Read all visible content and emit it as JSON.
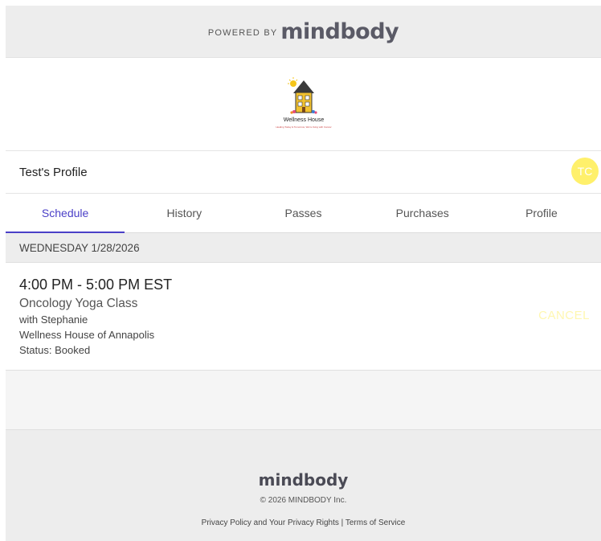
{
  "banner": {
    "powered_by": "POWERED BY",
    "brand": "mindbody"
  },
  "studio_logo": {
    "name": "Wellness House",
    "tagline": "Healing Today & Tomorrow, We're living with Cancer"
  },
  "profile": {
    "title": "Test's Profile",
    "avatar_initials": "TC"
  },
  "tabs": [
    {
      "label": "Schedule",
      "active": true
    },
    {
      "label": "History",
      "active": false
    },
    {
      "label": "Passes",
      "active": false
    },
    {
      "label": "Purchases",
      "active": false
    },
    {
      "label": "Profile",
      "active": false
    }
  ],
  "schedule": {
    "date_header": "WEDNESDAY 1/28/2026",
    "item": {
      "time": "4:00 PM - 5:00 PM EST",
      "class_name": "Oncology Yoga Class",
      "instructor": "with Stephanie",
      "location": "Wellness House of Annapolis",
      "status": "Status: Booked",
      "cancel_label": "CANCEL"
    }
  },
  "footer": {
    "brand": "mindbody",
    "copyright": "© 2026 MINDBODY Inc.",
    "privacy_link": "Privacy Policy and Your Privacy Rights",
    "separator": "|",
    "terms_link": "Terms of Service"
  },
  "colors": {
    "accent": "#4a3fc7",
    "avatar": "#fff06b",
    "cancel": "#fff7b0"
  }
}
